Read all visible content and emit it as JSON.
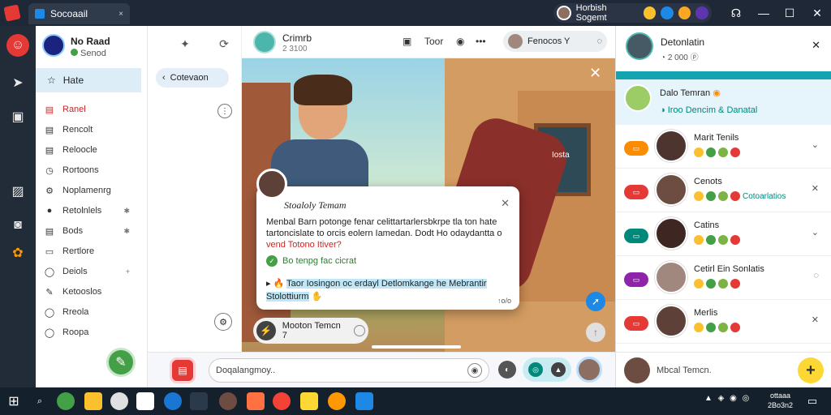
{
  "titlebar": {
    "tab_label": "Socoaail",
    "tab_close": "×",
    "user_name": "Horbish Sogemt",
    "window_controls": {
      "minimize": "—",
      "maximize": "☐",
      "close": "✕"
    }
  },
  "sidebar": {
    "profile_name": "No Raad",
    "profile_status": "Senod",
    "selected_item": "Hate",
    "items": [
      {
        "label": "Ranel",
        "icon": "▤",
        "trail": "",
        "active": true
      },
      {
        "label": "Rencolt",
        "icon": "▤",
        "trail": ""
      },
      {
        "label": "Reloocle",
        "icon": "▤",
        "trail": ""
      },
      {
        "label": "Rortoons",
        "icon": "◷",
        "trail": ""
      },
      {
        "label": "Noplamenrg",
        "icon": "⚙",
        "trail": ""
      },
      {
        "label": "Retolnlels",
        "icon": "●",
        "trail": "✱"
      },
      {
        "label": "Bods",
        "icon": "▤",
        "trail": "✱"
      },
      {
        "label": "Rertlore",
        "icon": "▭",
        "trail": ""
      },
      {
        "label": "Deiols",
        "icon": "◯",
        "trail": "+"
      },
      {
        "label": "Ketooslos",
        "icon": "✎",
        "trail": ""
      },
      {
        "label": "Rreola",
        "icon": "◯",
        "trail": ""
      },
      {
        "label": "Roopa",
        "icon": "◯",
        "trail": ""
      }
    ]
  },
  "midcol": {
    "search_label": "Cotevaon"
  },
  "chat": {
    "contact_name": "Crimrb",
    "contact_sub": "2 3100",
    "toolbar_text": "Toor",
    "call_chip_label": "Fenocos Y"
  },
  "video": {
    "side_text": "Iosta"
  },
  "card": {
    "title": "Stoaloly Temam",
    "body_line1": "Menbal  Barn potonge fenar celittartarlersbkrpe tla ton hate",
    "body_line2": "tartoncislate to orcis eolern Iamedan. Dodt Ho odaydantta o",
    "body_red": "vend Totono Itiver?",
    "ok_text": "Bo tenpg fac cicrat",
    "highlight": "Taor Iosingon oc erdayl  Detlomkange he Mebrantir",
    "highlight2": "Stolottiurm",
    "more": "↑o/o"
  },
  "reply_chip": {
    "label": "Mooton Temcn 7"
  },
  "input": {
    "placeholder": "Doqalangmoy.."
  },
  "right_panel": {
    "header_name": "Detonlatin",
    "header_sub": "2 000",
    "selected": {
      "name": "Dalo Temran",
      "status": "Iroo Dencim & Danatal"
    },
    "contacts": [
      {
        "name": "Marit Tenils",
        "status": "",
        "tag_color": "#fb8c00",
        "chev": "⌄",
        "av_color": "#4e342e"
      },
      {
        "name": "Cenots",
        "status": "Cotoarlatios",
        "tag_color": "#e53935",
        "chev": "✕",
        "av_color": "#6d4c41"
      },
      {
        "name": "Catins",
        "status": "",
        "tag_color": "#00897b",
        "chev": "⌄",
        "av_color": "#3e2723"
      },
      {
        "name": "Cetirl Ein Sonlatis",
        "status": "",
        "tag_color": "#8e24aa",
        "chev": "◌",
        "av_color": "#a1887f"
      },
      {
        "name": "Merlis",
        "status": "",
        "tag_color": "#e53935",
        "chev": "✕",
        "av_color": "#5d4037"
      }
    ],
    "input_label": "Mbcal Temcn.",
    "add_label": "+"
  },
  "taskbar": {
    "tray": "▲ ◈ ◉ ◎",
    "clock_time": "ottaaa",
    "clock_date": "2Bo3n2"
  },
  "colors": {
    "accent": "#14a3b1",
    "titlebar": "#1f2836",
    "taskbar": "#14202b"
  }
}
